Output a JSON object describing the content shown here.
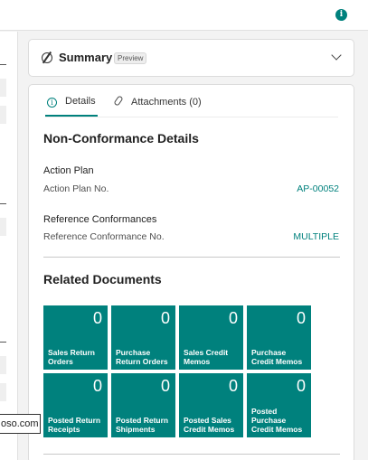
{
  "header": {
    "info_icon": "info-icon"
  },
  "left_panel": {
    "tooltip_text": "oso.com"
  },
  "summary": {
    "title": "Summary",
    "badge": "Preview",
    "icon": "summary-icon",
    "expand_icon": "chevron-down-icon"
  },
  "tabs": [
    {
      "label": "Details",
      "icon": "info-icon",
      "active": true
    },
    {
      "label": "Attachments (0)",
      "icon": "paperclip-icon",
      "active": false
    }
  ],
  "details": {
    "title": "Non-Conformance Details",
    "action_plan": {
      "group": "Action Plan",
      "label": "Action Plan No.",
      "value": "AP-00052"
    },
    "reference": {
      "group": "Reference Conformances",
      "label": "Reference Conformance No.",
      "value": "MULTIPLE"
    }
  },
  "related": {
    "title": "Related Documents",
    "tiles": [
      {
        "count": "0",
        "label": "Sales Return Orders"
      },
      {
        "count": "0",
        "label": "Purchase Return Orders"
      },
      {
        "count": "0",
        "label": "Sales Credit Memos"
      },
      {
        "count": "0",
        "label": "Purchase Credit Memos"
      },
      {
        "count": "0",
        "label": "Posted Return Receipts"
      },
      {
        "count": "0",
        "label": "Posted Return Shipments"
      },
      {
        "count": "0",
        "label": "Posted Sales Credit Memos"
      },
      {
        "count": "0",
        "label": "Posted Purchase Credit Memos"
      }
    ]
  },
  "colors": {
    "accent": "#00817d",
    "tile_bg": "#00817d"
  }
}
